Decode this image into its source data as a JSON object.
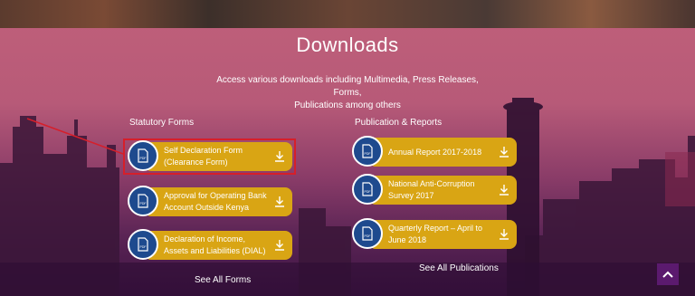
{
  "page": {
    "title": "Downloads",
    "subtitle_line1": "Access various downloads including Multimedia, Press Releases, Forms,",
    "subtitle_line2": "Publications among others"
  },
  "statutory": {
    "title": "Statutory Forms",
    "items": [
      {
        "line1": "Self Declaration Form",
        "line2": "(Clearance Form)"
      },
      {
        "line1": "Approval for Operating Bank",
        "line2": "Account Outside Kenya"
      },
      {
        "line1": "Declaration of Income,",
        "line2": "Assets and Liabilities (DIAL)"
      }
    ],
    "see_all": "See All Forms"
  },
  "publications": {
    "title": "Publication & Reports",
    "items": [
      {
        "line1": "Annual Report 2017-2018",
        "line2": ""
      },
      {
        "line1": "National Anti-Corruption",
        "line2": "Survey 2017"
      },
      {
        "line1": "Quarterly Report – April to",
        "line2": "June 2018"
      }
    ],
    "see_all": "See All Publications"
  },
  "icons": {
    "pdf": "pdf-file-icon",
    "download": "download-icon",
    "scroll_top": "chevron-up-icon"
  },
  "colors": {
    "pill": "#d9a514",
    "circle": "#1e4a8e",
    "highlight": "#d61f2a",
    "scroll_top": "#5b1a6e"
  }
}
